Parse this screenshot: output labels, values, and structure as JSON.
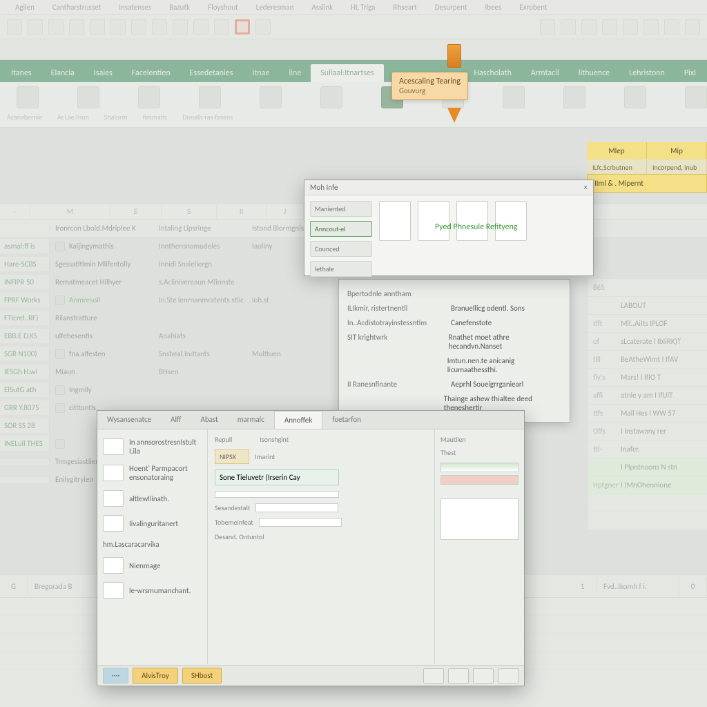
{
  "topmenu": [
    "Agilen",
    "Cantharstrusset",
    "Insatenses",
    "Bazutk",
    "Floyshout",
    "Lederesman",
    "Assiink",
    "HL Triga",
    "Rhseart",
    "Desurpent",
    "Ibees",
    "Exrobent"
  ],
  "callout": {
    "l1": "Acescaling Tearing",
    "l2": "Gouvurg"
  },
  "ribbon": {
    "tabs": [
      "Itanes",
      "Elancia",
      "Isaies",
      "Facelentien",
      "Essedetanies",
      "Itnae",
      "line",
      "Sullaal:Itnartses",
      "Hascholath",
      "Armtacil",
      "lithuence",
      "Lehristonn",
      "PixI"
    ],
    "active_index": 7,
    "groups": [
      "",
      "",
      "",
      "",
      "",
      "",
      "",
      "",
      "",
      "",
      ""
    ],
    "sublabels": [
      "Acanabernie",
      "Ar.Lae.Inon",
      "Stialorm",
      "fimmatic",
      "Donalh-ras-fasens"
    ]
  },
  "row_headers": [
    "",
    "Ironrcon Lbold.Mdriplee K",
    "Intaling Lipsringe",
    "Istond Blormgniset",
    ""
  ],
  "rows": [
    {
      "id": "asmal:ff is",
      "c1": "Kaijingymathis",
      "c2": "Innthensnamudeles",
      "c3": "Iauliny",
      "ico": true
    },
    {
      "id": "Hare-SCBS",
      "c1": "Sgessatitimin Mlifentolly",
      "c2": "Innidi Snaieliergn",
      "c3": "",
      "ico": false
    },
    {
      "id": "INFIPR 50",
      "c1": "Rematmeacet  Hilhyer",
      "c2": "s.Aclinivereaun  Mlinnste",
      "c3": "",
      "ico": false
    },
    {
      "id": "FPRF Works",
      "c1": "Anmresoll",
      "c2": "In.Ste lenrnanmratents.stlic",
      "c3": "loh.st",
      "ico": true,
      "g": true
    },
    {
      "id": "FTIcrel..RF)",
      "c1": "Rilanstratture",
      "c2": "",
      "c3": "",
      "ico": false
    },
    {
      "id": "EBB.E D.KS",
      "c1": "ulfehesentis",
      "c2": "Anahiats",
      "c3": "",
      "ico": false
    },
    {
      "id": "SGR N100)",
      "c1": "fna.alfesten",
      "c2": "Snsheal.Indtants",
      "c3": "Multtuen",
      "ico": true
    },
    {
      "id": "IESGh  H.wi",
      "c1": "Miaun",
      "c2": "BHsen",
      "c3": "",
      "ico": false
    },
    {
      "id": "ElSutG  ath",
      "c1": "Ingmily",
      "c2": "",
      "c3": "",
      "ico": true
    },
    {
      "id": "GRR Y.8075",
      "c1": "cititontls",
      "c2": "",
      "c3": "",
      "ico": true
    },
    {
      "id": "SOR SS 28",
      "c1": "",
      "c2": "",
      "c3": "",
      "ico": false
    },
    {
      "id": "INELull  THES",
      "c1": "",
      "c2": "",
      "c3": "",
      "ico": true
    },
    {
      "id": "",
      "c1": "Trmgesiastliensfen",
      "c2": "",
      "c3": "",
      "ico": false
    },
    {
      "id": "",
      "c1": "Enilygitryien",
      "c2": "",
      "c3": "",
      "ico": false
    }
  ],
  "right_yellow": {
    "a": "Mlep",
    "b": "Mip",
    "c": "ILfc,Scrbutnen",
    "d": "Incorpend, inub",
    "e": "IIml & . Mipernt"
  },
  "rpanel": [
    {
      "n": "865",
      "t": "",
      "g": false
    },
    {
      "n": "",
      "t": "LABOUT",
      "g": false
    },
    {
      "n": "tfft",
      "t": "Mll..AiIts   IPLOF",
      "g": false
    },
    {
      "n": "of",
      "t": "sLcaterate l IbIiRK)T",
      "g": false
    },
    {
      "n": "fill",
      "t": "BeAtheWimt  I IfAV",
      "g": false
    },
    {
      "n": "fly's",
      "t": "Mars!    I IfIO T",
      "g": false
    },
    {
      "n": "affi",
      "t": "atnle  y am  I IfUlT",
      "g": false
    },
    {
      "n": "ttfs",
      "t": "Mall Hes  l WW 57",
      "g": false
    },
    {
      "n": "Offs",
      "t": "I Instawany rer",
      "g": false
    },
    {
      "n": "ttl-",
      "t": "Inafer.",
      "g": false
    },
    {
      "n": "",
      "t": "I Plpntnoons N stn",
      "g": true
    },
    {
      "n": "Hptgner",
      "t": "I (MnOhennione",
      "g": true
    }
  ],
  "dlg1": {
    "title": "Moh Infe",
    "side": [
      "Maniented",
      "Anncout-el",
      "Counced",
      "lethale"
    ],
    "green": "Pyed Phnesule Refityeng"
  },
  "side_dlg": {
    "rows": [
      {
        "l": "Bpertodnle anntham",
        "r": ""
      },
      {
        "l": "ILIkmir, ristertnentil",
        "r": "Branuellicg odentl. Sons"
      },
      {
        "l": "In..Acdistotrayinstessntim",
        "r": "Canefenstote"
      },
      {
        "l": "SIT krightwrk",
        "r": "Rnathet moet athre hecandvn.Nanset"
      },
      {
        "l": "",
        "r": "Imtun.nen.te anicanig licumaathessthi."
      },
      {
        "l": "II Ranesnfinante",
        "r": "Aeprhl Soueigrrganiearl"
      },
      {
        "l": "",
        "r": "Thainge ashew  thialtee deed theneshertir"
      }
    ]
  },
  "bottom_dlg": {
    "tabs": [
      "Wysansenatce",
      "Alff",
      "Abast",
      "marmalc",
      "Annoffek",
      "foetarfon"
    ],
    "active_tab": 4,
    "left": [
      {
        "t": "In annsorostresnIstult I.ila"
      },
      {
        "t": "Hoent'\nParmpacort\nensonatoraing"
      },
      {
        "t": "altlewllinath."
      },
      {
        "t": "Iivalinguritanert"
      },
      {
        "t": "hm.Lascaracarvika"
      },
      {
        "t": "Nienmage"
      },
      {
        "t": "le-wrsmumanchant."
      }
    ],
    "mid_label": "Repull",
    "mid_fields": [
      "Imarint",
      "Sone Tieluvetr (Irserin Cay",
      "",
      "Sesandestalt",
      "Tobemeinfeat",
      "Desand. Ontuntol"
    ],
    "right_head": "Mautlien",
    "right_sub": "Thest",
    "btn_a": "AlvisTroy",
    "btn_b": "SHbost"
  },
  "bottom_bar": {
    "a": "G",
    "b": "Bregorada B",
    "r1": "1",
    "r2": "Fvd..Ikomh f i.",
    "r3": "0"
  }
}
